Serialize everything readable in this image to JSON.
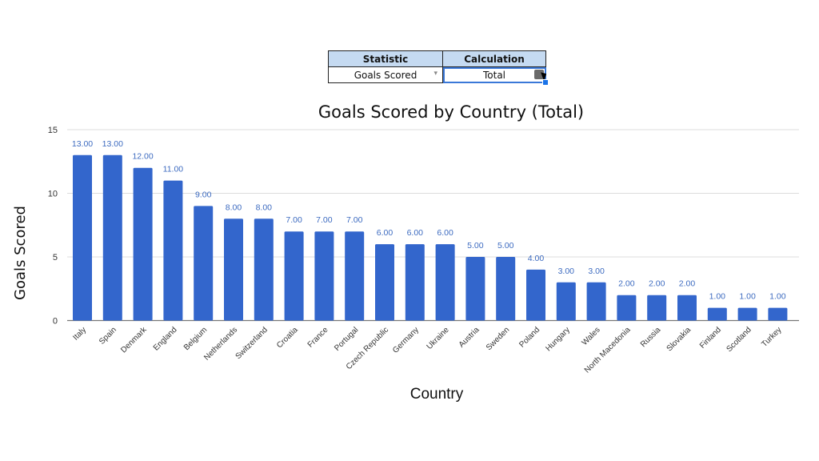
{
  "controls": {
    "headers": [
      "Statistic",
      "Calculation"
    ],
    "statistic_value": "Goals Scored",
    "calculation_value": "Total",
    "dropdown_arrow": "▾"
  },
  "chart_data": {
    "type": "bar",
    "title": "Goals Scored by Country (Total)",
    "xlabel": "Country",
    "ylabel": "Goals Scored",
    "ylim": [
      0,
      15
    ],
    "yticks": [
      0,
      5,
      10,
      15
    ],
    "grid": true,
    "legend": "none",
    "bar_color": "#3366cc",
    "label_color": "#3d6bc0",
    "categories": [
      "Italy",
      "Spain",
      "Denmark",
      "England",
      "Belgium",
      "Netherlands",
      "Switzerland",
      "Croatia",
      "France",
      "Portugal",
      "Czech Republic",
      "Germany",
      "Ukraine",
      "Austria",
      "Sweden",
      "Poland",
      "Hungary",
      "Wales",
      "North Macedonia",
      "Russia",
      "Slovakia",
      "Finland",
      "Scotland",
      "Turkey"
    ],
    "values": [
      13,
      13,
      12,
      11,
      9,
      8,
      8,
      7,
      7,
      7,
      6,
      6,
      6,
      5,
      5,
      4,
      3,
      3,
      2,
      2,
      2,
      1,
      1,
      1
    ],
    "data_labels": [
      "13.00",
      "13.00",
      "12.00",
      "11.00",
      "9.00",
      "8.00",
      "8.00",
      "7.00",
      "7.00",
      "7.00",
      "6.00",
      "6.00",
      "6.00",
      "5.00",
      "5.00",
      "4.00",
      "3.00",
      "3.00",
      "2.00",
      "2.00",
      "2.00",
      "1.00",
      "1.00",
      "1.00"
    ]
  }
}
